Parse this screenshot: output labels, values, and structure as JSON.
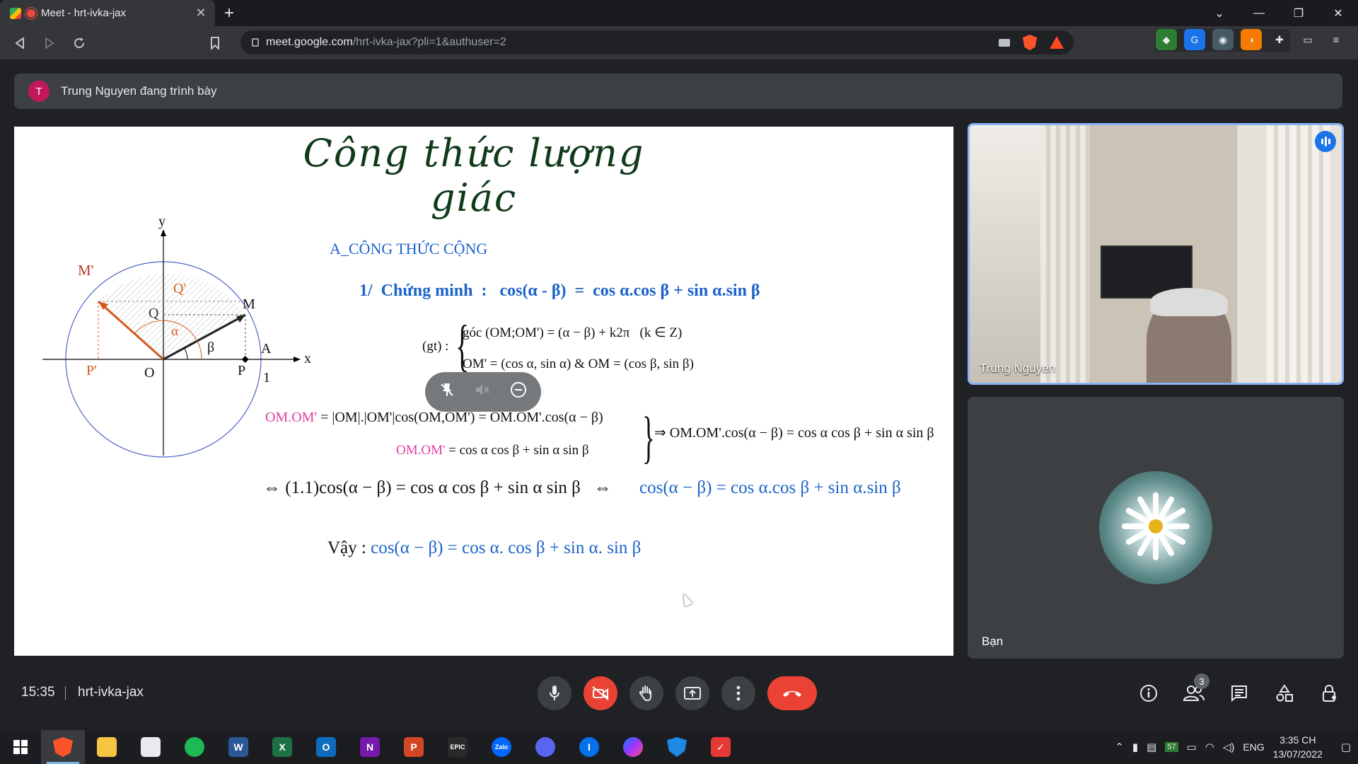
{
  "browser": {
    "tab_title": "Meet - hrt-ivka-jax",
    "tab_close": "✕",
    "new_tab": "+",
    "window_controls": [
      "⌄",
      "—",
      "❐",
      "✕"
    ],
    "url_host": "meet.google.com",
    "url_path": "/hrt-ivka-jax?pli=1&authuser=2"
  },
  "presenting": {
    "avatar_letter": "T",
    "text": "Trung Nguyen đang trình bày"
  },
  "slide": {
    "title": "Công thức lượng giác",
    "section": "A_CÔNG THỨC CỘNG",
    "proof_title": "1/  Chứng minh  :   cos(α - β)  =  cos α.cos β + sin α.sin β",
    "gt_label": "(gt) :",
    "gt_line1": "góc (OM;OM') = (α − β) + k2π   (k ∈ Z)",
    "gt_line2": "OM' = (cos α, sin α) & OM = (cos β, sin β)",
    "dot_line1_pink": "OM.OM'",
    "dot_line1_rest": " = |OM|.|OM'|cos(OM,OM') = OM.OM'.cos(α − β)",
    "dot_line2_pink": "OM.OM'",
    "dot_line2_rest": " = cos α cos β + sin α sin β",
    "implies": "⇒ OM.OM'.cos(α − β) = cos α cos β + sin α sin β",
    "equiv_black": "⇔ (1.1)cos(α − β) = cos α cos β + sin α sin β   ⇔",
    "equiv_blue": "cos(α − β) = cos α.cos β + sin α.sin β",
    "vay_label": "Vậy : ",
    "vay_formula": "cos(α − β) = cos α. cos β + sin α. sin β",
    "diagram": {
      "y": "y",
      "x": "x",
      "M_prime": "M'",
      "Q_prime": "Q'",
      "Q": "Q",
      "M": "M",
      "alpha": "α",
      "beta": "β",
      "A": "A",
      "P_prime": "P'",
      "O": "O",
      "P": "P",
      "one": "1"
    }
  },
  "tiles": {
    "presenter_name": "Trung Nguyen",
    "you_name": "Bạn"
  },
  "bottom": {
    "time": "15:35",
    "meeting_code": "hrt-ivka-jax",
    "participants_count": "3"
  },
  "taskbar": {
    "lang": "ENG",
    "time": "3:35 CH",
    "date": "13/07/2022",
    "battery_badge": "57"
  },
  "colors": {
    "accent_blue": "#1b63c9",
    "pink": "#e23da2",
    "end_call": "#ea4335",
    "active_tile_border": "#8ab4f8"
  }
}
